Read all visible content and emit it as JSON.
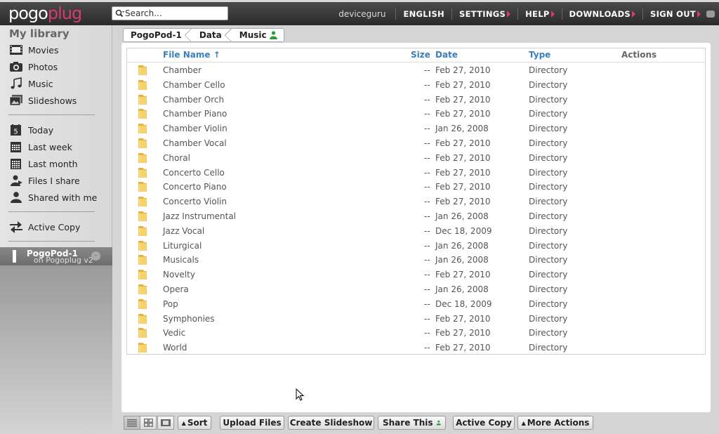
{
  "header": {
    "logo_part1": "pogo",
    "logo_part2": "plug",
    "search_placeholder": "Search...",
    "username": "deviceguru",
    "nav": [
      "ENGLISH",
      "SETTINGS",
      "HELP",
      "DOWNLOADS",
      "SIGN OUT"
    ]
  },
  "sidebar": {
    "heading": "My library",
    "media": [
      {
        "label": "Movies",
        "icon": "film-icon"
      },
      {
        "label": "Photos",
        "icon": "camera-icon"
      },
      {
        "label": "Music",
        "icon": "music-note-icon"
      },
      {
        "label": "Slideshows",
        "icon": "slideshow-icon"
      }
    ],
    "time": [
      {
        "label": "Today",
        "icon": "calendar-day-icon",
        "badge": "5"
      },
      {
        "label": "Last week",
        "icon": "calendar-week-icon"
      },
      {
        "label": "Last month",
        "icon": "calendar-month-icon"
      },
      {
        "label": "Files I share",
        "icon": "share-user-icon"
      },
      {
        "label": "Shared with me",
        "icon": "user-icon"
      }
    ],
    "active_copy": "Active Copy",
    "device": {
      "name": "PogoPod-1",
      "sub": "on Pogoplug v2"
    }
  },
  "breadcrumb": [
    "PogoPod-1",
    "Data",
    "Music"
  ],
  "table": {
    "columns": {
      "name": "File Name",
      "size": "Size",
      "date": "Date",
      "type": "Type",
      "actions": "Actions"
    },
    "sort_indicator": "↑",
    "rows": [
      {
        "name": "Chamber",
        "size": "--",
        "date": "Feb 27, 2010",
        "type": "Directory"
      },
      {
        "name": "Chamber Cello",
        "size": "--",
        "date": "Feb 27, 2010",
        "type": "Directory"
      },
      {
        "name": "Chamber Orch",
        "size": "--",
        "date": "Feb 27, 2010",
        "type": "Directory"
      },
      {
        "name": "Chamber Piano",
        "size": "--",
        "date": "Feb 27, 2010",
        "type": "Directory"
      },
      {
        "name": "Chamber Violin",
        "size": "--",
        "date": "Jan 26, 2008",
        "type": "Directory"
      },
      {
        "name": "Chamber Vocal",
        "size": "--",
        "date": "Feb 27, 2010",
        "type": "Directory"
      },
      {
        "name": "Choral",
        "size": "--",
        "date": "Feb 27, 2010",
        "type": "Directory"
      },
      {
        "name": "Concerto Cello",
        "size": "--",
        "date": "Feb 27, 2010",
        "type": "Directory"
      },
      {
        "name": "Concerto Piano",
        "size": "--",
        "date": "Feb 27, 2010",
        "type": "Directory"
      },
      {
        "name": "Concerto Violin",
        "size": "--",
        "date": "Feb 27, 2010",
        "type": "Directory"
      },
      {
        "name": "Jazz Instrumental",
        "size": "--",
        "date": "Jan 26, 2008",
        "type": "Directory"
      },
      {
        "name": "Jazz Vocal",
        "size": "--",
        "date": "Dec 18, 2009",
        "type": "Directory"
      },
      {
        "name": "Liturgical",
        "size": "--",
        "date": "Jan 26, 2008",
        "type": "Directory"
      },
      {
        "name": "Musicals",
        "size": "--",
        "date": "Jan 26, 2008",
        "type": "Directory"
      },
      {
        "name": "Novelty",
        "size": "--",
        "date": "Feb 27, 2010",
        "type": "Directory"
      },
      {
        "name": "Opera",
        "size": "--",
        "date": "Jan 26, 2008",
        "type": "Directory"
      },
      {
        "name": "Pop",
        "size": "--",
        "date": "Dec 18, 2009",
        "type": "Directory"
      },
      {
        "name": "Symphonies",
        "size": "--",
        "date": "Feb 27, 2010",
        "type": "Directory"
      },
      {
        "name": "Vedic",
        "size": "--",
        "date": "Feb 27, 2010",
        "type": "Directory"
      },
      {
        "name": "World",
        "size": "--",
        "date": "Feb 27, 2010",
        "type": "Directory"
      }
    ]
  },
  "toolbar": {
    "sort": "Sort",
    "upload": "Upload Files",
    "slideshow": "Create Slideshow",
    "share": "Share This",
    "active_copy": "Active Copy",
    "more": "More Actions"
  },
  "colors": {
    "accent": "#d63a6f",
    "link": "#3a7dc0",
    "folder": "#f2c84b"
  }
}
